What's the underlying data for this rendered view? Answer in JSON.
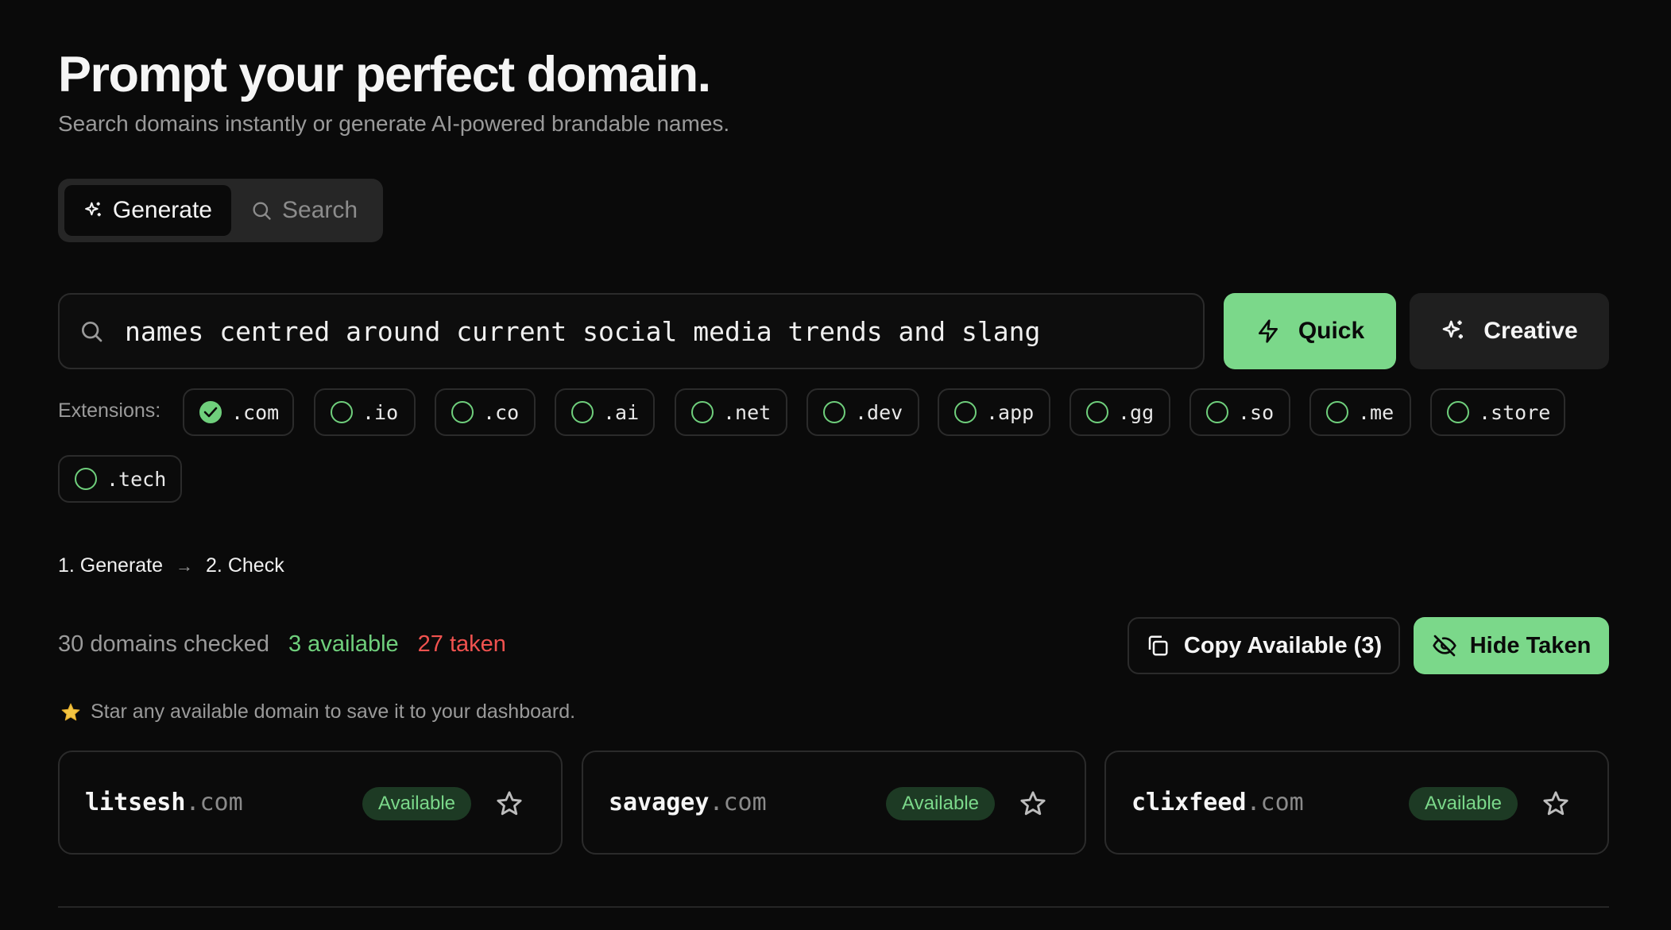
{
  "header": {
    "title": "Prompt your perfect domain.",
    "subtitle": "Search domains instantly or generate AI-powered brandable names."
  },
  "mode_toggle": {
    "generate_label": "Generate",
    "search_label": "Search",
    "active": "generate"
  },
  "prompt": {
    "value": "names centred around current social media trends and slang",
    "quick_label": "Quick",
    "creative_label": "Creative"
  },
  "extensions": {
    "label": "Extensions:",
    "items": [
      {
        "label": ".com",
        "checked": true
      },
      {
        "label": ".io",
        "checked": false
      },
      {
        "label": ".co",
        "checked": false
      },
      {
        "label": ".ai",
        "checked": false
      },
      {
        "label": ".net",
        "checked": false
      },
      {
        "label": ".dev",
        "checked": false
      },
      {
        "label": ".app",
        "checked": false
      },
      {
        "label": ".gg",
        "checked": false
      },
      {
        "label": ".so",
        "checked": false
      },
      {
        "label": ".me",
        "checked": false
      },
      {
        "label": ".store",
        "checked": false
      },
      {
        "label": ".tech",
        "checked": false
      }
    ]
  },
  "steps": {
    "step1": "1. Generate",
    "arrow": "→",
    "step2": "2. Check"
  },
  "stats": {
    "checked": "30 domains checked",
    "available": "3 available",
    "taken": "27 taken"
  },
  "actions": {
    "copy_label": "Copy Available (3)",
    "hide_label": "Hide Taken"
  },
  "hint": "Star any available domain to save it to your dashboard.",
  "results": [
    {
      "name": "litsesh",
      "tld": ".com",
      "status": "Available"
    },
    {
      "name": "savagey",
      "tld": ".com",
      "status": "Available"
    },
    {
      "name": "clixfeed",
      "tld": ".com",
      "status": "Available"
    }
  ],
  "colors": {
    "accent": "#7bd88a",
    "available": "#6fcf7c",
    "taken": "#f0524f",
    "background": "#0a0a0a"
  }
}
